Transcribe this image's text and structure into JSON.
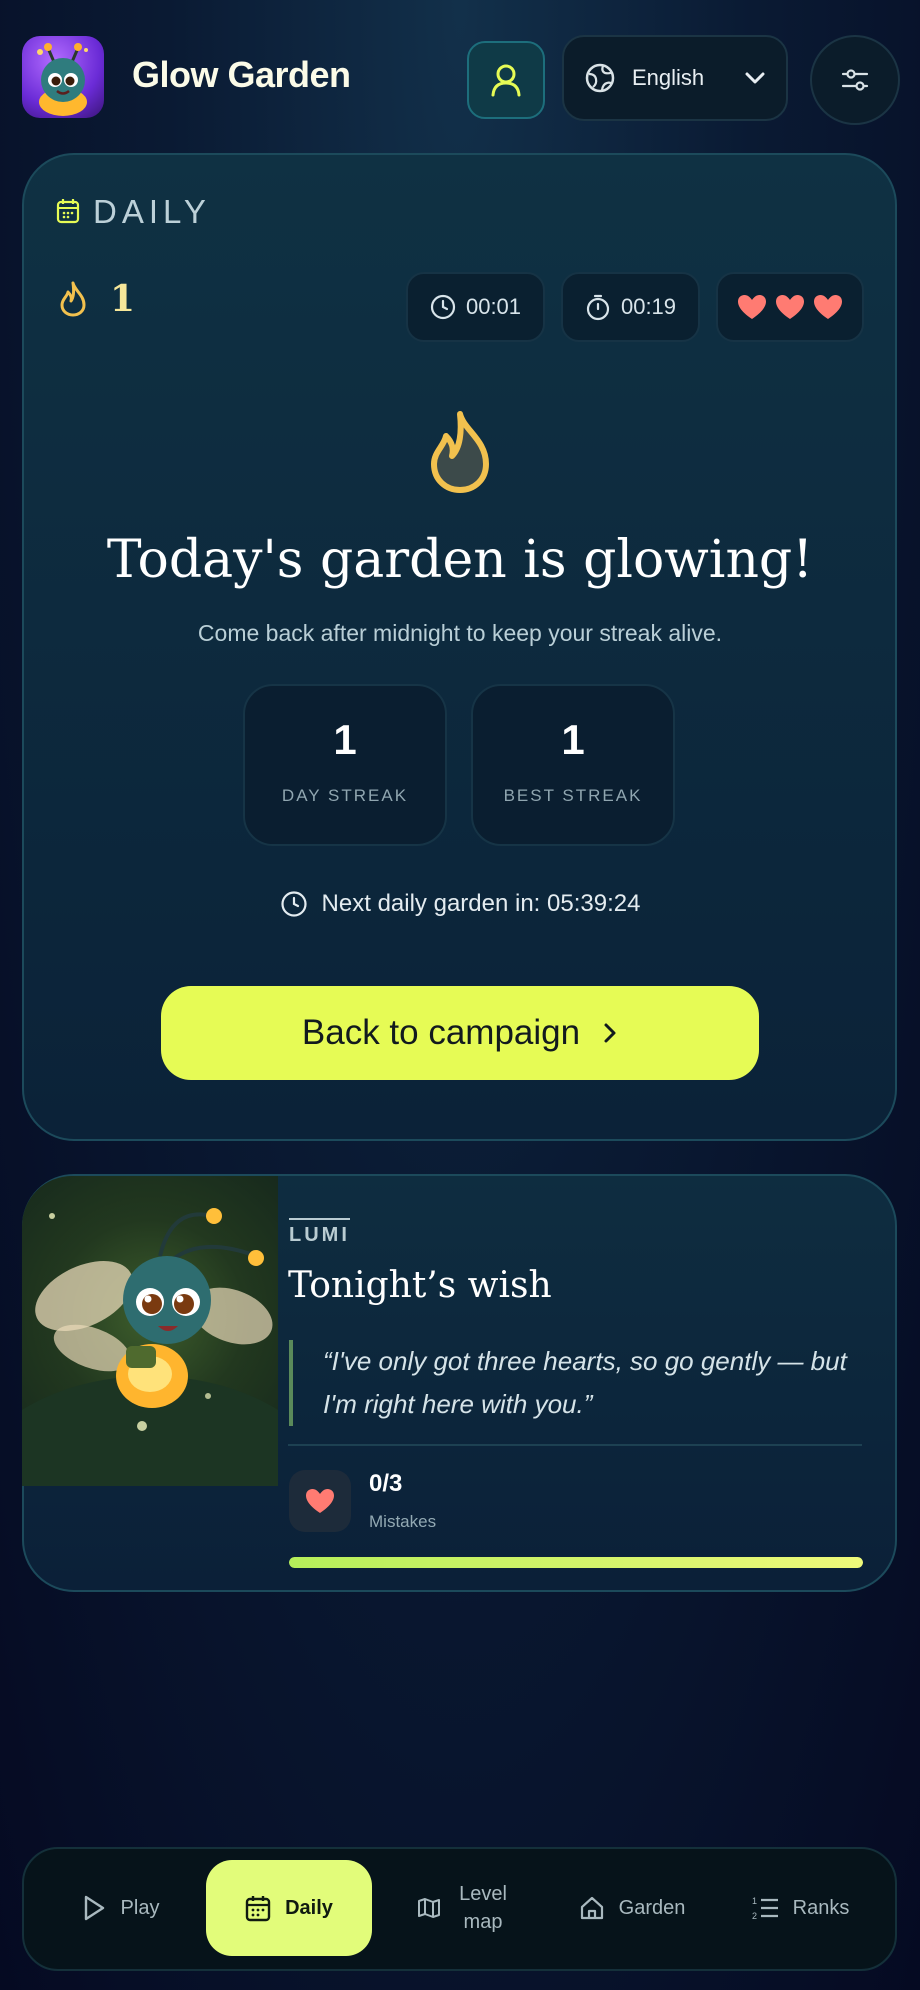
{
  "header": {
    "app_title": "Glow Garden",
    "language": "English"
  },
  "daily": {
    "section_label": "DAILY",
    "streak_count": "1",
    "timer_elapsed": "00:01",
    "timer_stopwatch": "00:19",
    "hearts_remaining": 3,
    "headline": "Today's garden is glowing!",
    "subline": "Come back after midnight to keep your streak alive.",
    "stats": [
      {
        "value": "1",
        "label": "DAY STREAK"
      },
      {
        "value": "1",
        "label": "BEST STREAK"
      }
    ],
    "next_label": "Next daily garden in: 05:39:24",
    "cta_label": "Back to campaign"
  },
  "companion": {
    "name": "LUMI",
    "title": "Tonight’s wish",
    "quote": "“I've only got three hearts, so go gently — but I'm right here with you.”",
    "mistakes_value": "0/3",
    "mistakes_label": "Mistakes",
    "progress_fraction": 1.0
  },
  "nav": {
    "items": [
      {
        "label": "Play",
        "icon": "play-icon"
      },
      {
        "label": "Daily",
        "icon": "calendar-icon",
        "active": true
      },
      {
        "label": "Level map",
        "icon": "map-icon"
      },
      {
        "label": "Garden",
        "icon": "home-icon"
      },
      {
        "label": "Ranks",
        "icon": "list-ordered-icon"
      }
    ]
  },
  "colors": {
    "accent": "#e6fb55",
    "heart": "#ff7b72",
    "flame": "#f2c14e",
    "background": "#050a22"
  }
}
